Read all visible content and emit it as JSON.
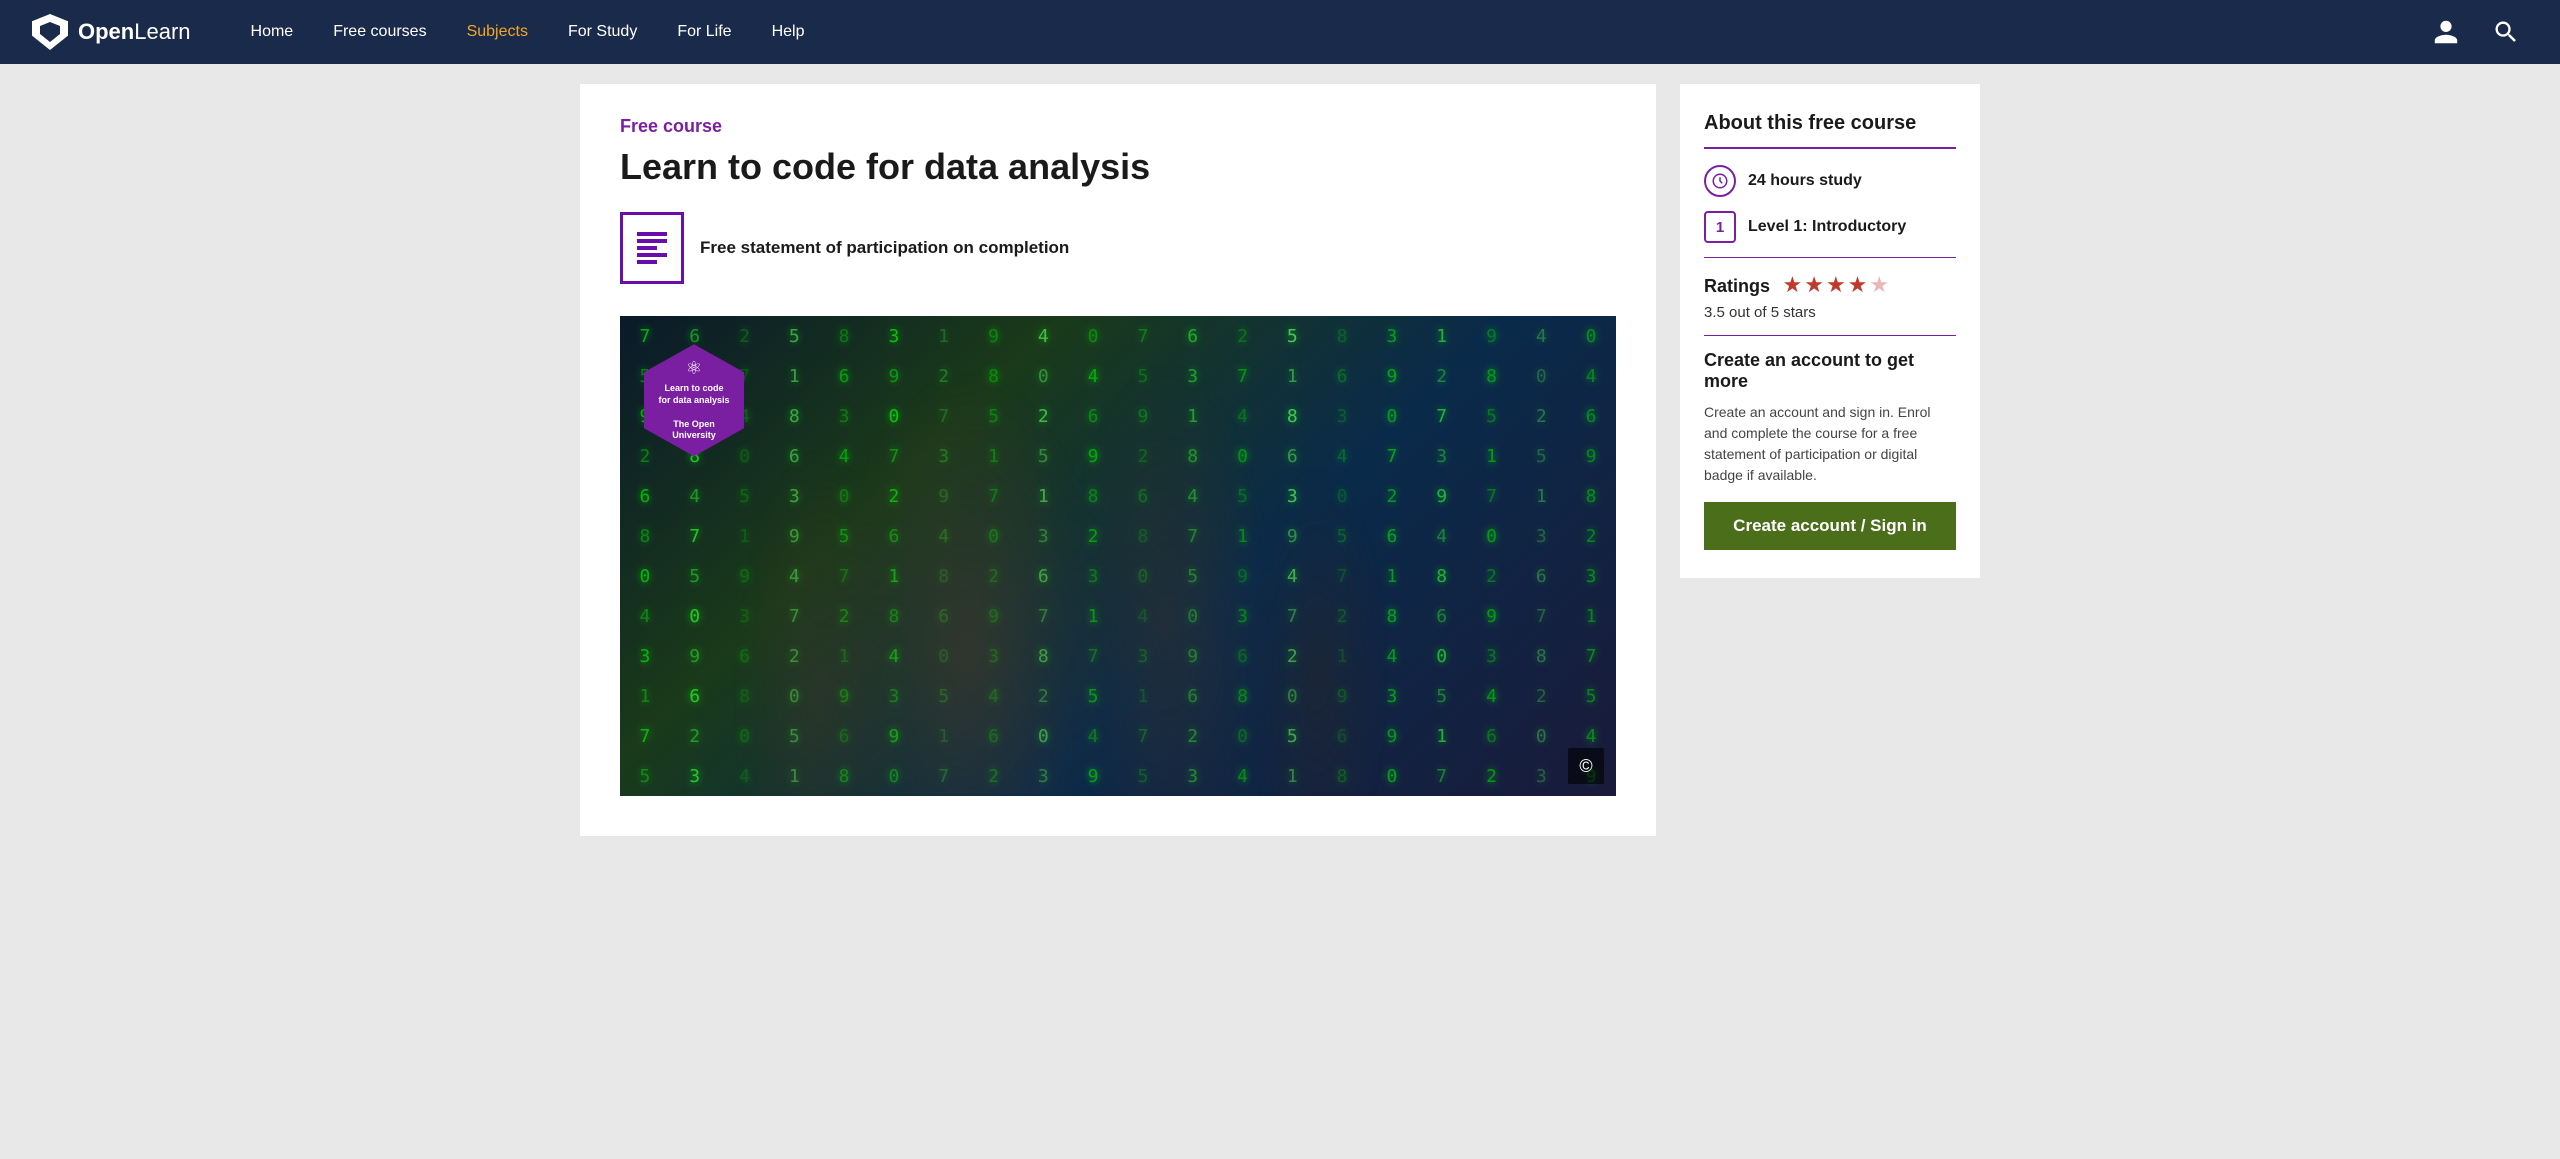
{
  "nav": {
    "logo_text_open": "Open",
    "logo_text_learn": "Learn",
    "links": [
      {
        "id": "home",
        "label": "Home",
        "active": false
      },
      {
        "id": "free-courses",
        "label": "Free courses",
        "active": false
      },
      {
        "id": "subjects",
        "label": "Subjects",
        "active": true
      },
      {
        "id": "for-study",
        "label": "For Study",
        "active": false
      },
      {
        "id": "for-life",
        "label": "For Life",
        "active": false
      },
      {
        "id": "help",
        "label": "Help",
        "active": false
      }
    ]
  },
  "course": {
    "free_label": "Free course",
    "title": "Learn to code for data analysis",
    "cert_text": "Free statement of participation on completion",
    "hex_line1": "Learn to code",
    "hex_line2": "for data analysis",
    "hex_line3": "The Open University"
  },
  "sidebar": {
    "title": "About this free course",
    "hours_label": "24 hours study",
    "level_label": "Level 1: Introductory",
    "ratings_title": "Ratings",
    "ratings_score": "3.5 out of 5 stars",
    "cta_title": "Create an account to get more",
    "cta_desc": "Create an account and sign in. Enrol and complete the course for a free statement of participation or digital badge if available.",
    "cta_button": "Create account / Sign in"
  },
  "matrix_chars": [
    "7",
    "6",
    "2",
    "5",
    "8",
    "3",
    "1",
    "9",
    "4",
    "0",
    "7",
    "6",
    "2",
    "5",
    "8",
    "3",
    "1",
    "9",
    "4",
    "0",
    "5",
    "3",
    "7",
    "1",
    "6",
    "9",
    "2",
    "8",
    "0",
    "4",
    "5",
    "3",
    "7",
    "1",
    "6",
    "9",
    "2",
    "8",
    "0",
    "4",
    "9",
    "1",
    "4",
    "8",
    "3",
    "0",
    "7",
    "5",
    "2",
    "6",
    "9",
    "1",
    "4",
    "8",
    "3",
    "0",
    "7",
    "5",
    "2",
    "6",
    "2",
    "8",
    "0",
    "6",
    "4",
    "7",
    "3",
    "1",
    "5",
    "9",
    "2",
    "8",
    "0",
    "6",
    "4",
    "7",
    "3",
    "1",
    "5",
    "9",
    "6",
    "4",
    "5",
    "3",
    "0",
    "2",
    "9",
    "7",
    "1",
    "8",
    "6",
    "4",
    "5",
    "3",
    "0",
    "2",
    "9",
    "7",
    "1",
    "8",
    "8",
    "7",
    "1",
    "9",
    "5",
    "6",
    "4",
    "0",
    "3",
    "2",
    "8",
    "7",
    "1",
    "9",
    "5",
    "6",
    "4",
    "0",
    "3",
    "2",
    "0",
    "5",
    "9",
    "4",
    "7",
    "1",
    "8",
    "2",
    "6",
    "3",
    "0",
    "5",
    "9",
    "4",
    "7",
    "1",
    "8",
    "2",
    "6",
    "3",
    "4",
    "0",
    "3",
    "7",
    "2",
    "8",
    "6",
    "9",
    "7",
    "1",
    "4",
    "0",
    "3",
    "7",
    "2",
    "8",
    "6",
    "9",
    "7",
    "1",
    "3",
    "9",
    "6",
    "2",
    "1",
    "4",
    "0",
    "3",
    "8",
    "7",
    "3",
    "9",
    "6",
    "2",
    "1",
    "4",
    "0",
    "3",
    "8",
    "7",
    "1",
    "6",
    "8",
    "0",
    "9",
    "3",
    "5",
    "4",
    "2",
    "5",
    "1",
    "6",
    "8",
    "0",
    "9",
    "3",
    "5",
    "4",
    "2",
    "5",
    "7",
    "2",
    "0",
    "5",
    "6",
    "9",
    "1",
    "6",
    "0",
    "4",
    "7",
    "2",
    "0",
    "5",
    "6",
    "9",
    "1",
    "6",
    "0",
    "4",
    "5",
    "3",
    "4",
    "1",
    "8",
    "0",
    "7",
    "2",
    "3",
    "9",
    "5",
    "3",
    "4",
    "1",
    "8",
    "0",
    "7",
    "2",
    "3",
    "9"
  ]
}
